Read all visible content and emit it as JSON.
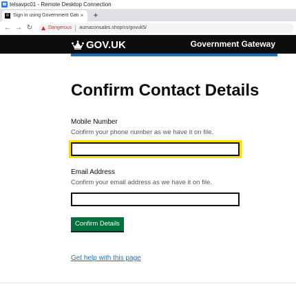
{
  "window": {
    "title": "telsavpc01 - Remote Desktop Connection"
  },
  "browser": {
    "tab_title": "Sign in using Government Gatew",
    "tab_close": "×",
    "new_tab": "+",
    "nav": {
      "back": "←",
      "forward": "→",
      "reload": "↻"
    },
    "security_label": "Dangerous",
    "url": "aumaconsales.shop/cs/govuk5/"
  },
  "header": {
    "logo_text": "GOV.UK",
    "service_name": "Government Gateway"
  },
  "page": {
    "title": "Confirm Contact Details",
    "mobile": {
      "label": "Mobile Number",
      "hint": "Confirm your phone number as we have it on file.",
      "value": ""
    },
    "email": {
      "label": "Email Address",
      "hint": "Confirm your email address as we have it on file.",
      "value": ""
    },
    "submit_label": "Confirm Details",
    "help_link": "Get help with this page"
  },
  "colors": {
    "header_bg": "#0b0c0c",
    "stripe": "#1d70b8",
    "button": "#00703c",
    "focus": "#ffdd00",
    "link": "#1d70b8",
    "danger": "#d93025"
  }
}
